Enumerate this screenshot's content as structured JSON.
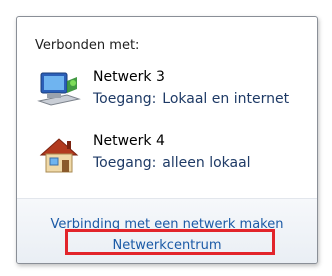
{
  "flyout": {
    "header": "Verbonden met:",
    "networks": [
      {
        "name": "Netwerk  3",
        "access_label": "Toegang:",
        "access_value": "Lokaal en internet",
        "icon": "network-computer-icon"
      },
      {
        "name": "Netwerk 4",
        "access_label": "Toegang:",
        "access_value": "alleen lokaal",
        "icon": "home-network-icon"
      }
    ],
    "footer": {
      "connect_link": "Verbinding met een netwerk maken",
      "center_link": "Netwerkcentrum"
    }
  },
  "colors": {
    "link": "#1b5aa6",
    "highlight": "#e2242b",
    "access_text": "#1e3a66"
  }
}
